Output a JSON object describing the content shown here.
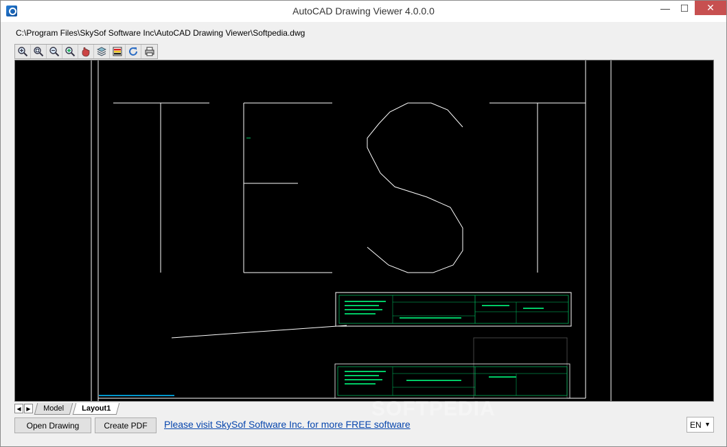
{
  "window": {
    "title": "AutoCAD Drawing Viewer 4.0.0.0",
    "minimize": "—",
    "maximize": "☐",
    "close": "✕"
  },
  "file_path": "C:\\Program Files\\SkySof Software Inc\\AutoCAD Drawing Viewer\\Softpedia.dwg",
  "toolbar": {
    "buttons": [
      {
        "name": "zoom-in-icon"
      },
      {
        "name": "zoom-window-icon"
      },
      {
        "name": "zoom-out-icon"
      },
      {
        "name": "zoom-extents-icon"
      },
      {
        "name": "pan-icon"
      },
      {
        "name": "layers-icon"
      },
      {
        "name": "colors-icon"
      },
      {
        "name": "refresh-icon"
      },
      {
        "name": "print-icon"
      }
    ]
  },
  "tabs": {
    "prev": "◀",
    "next": "▶",
    "items": [
      {
        "label": "Model",
        "active": false
      },
      {
        "label": "Layout1",
        "active": true
      }
    ]
  },
  "drawing": {
    "text": "TEST",
    "colors": {
      "background": "#000000",
      "lines": "#ffffff",
      "title_block": "#00c864",
      "detail": "#00d0ff"
    }
  },
  "watermark": "SOFTPEDIA",
  "buttons": {
    "open_drawing": "Open Drawing",
    "create_pdf": "Create PDF"
  },
  "promo_link": "Please visit SkySof Software Inc. for more FREE software",
  "language": {
    "selected": "EN"
  }
}
